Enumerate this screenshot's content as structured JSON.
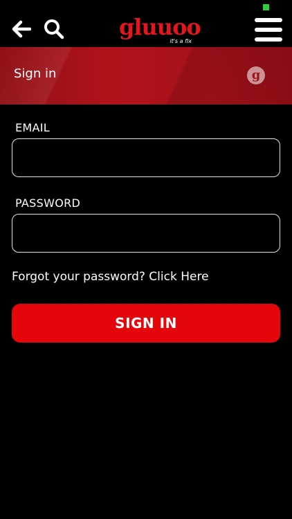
{
  "header": {
    "logo_text": "gluuoo",
    "logo_tagline": "it's a fix",
    "icons": {
      "back": "back-arrow-icon",
      "search": "search-icon",
      "menu": "hamburger-menu-icon"
    },
    "status_color": "#2ecc40",
    "brand_color": "#e4161b"
  },
  "banner": {
    "title": "Sign in",
    "badge_letter": "g"
  },
  "form": {
    "email_label": "EMAIL",
    "email_value": "",
    "password_label": "PASSWORD",
    "password_value": "",
    "forgot_text": "Forgot your password? ",
    "forgot_link": "Click Here",
    "submit_label": "SIGN IN",
    "submit_color": "#e5060c"
  }
}
